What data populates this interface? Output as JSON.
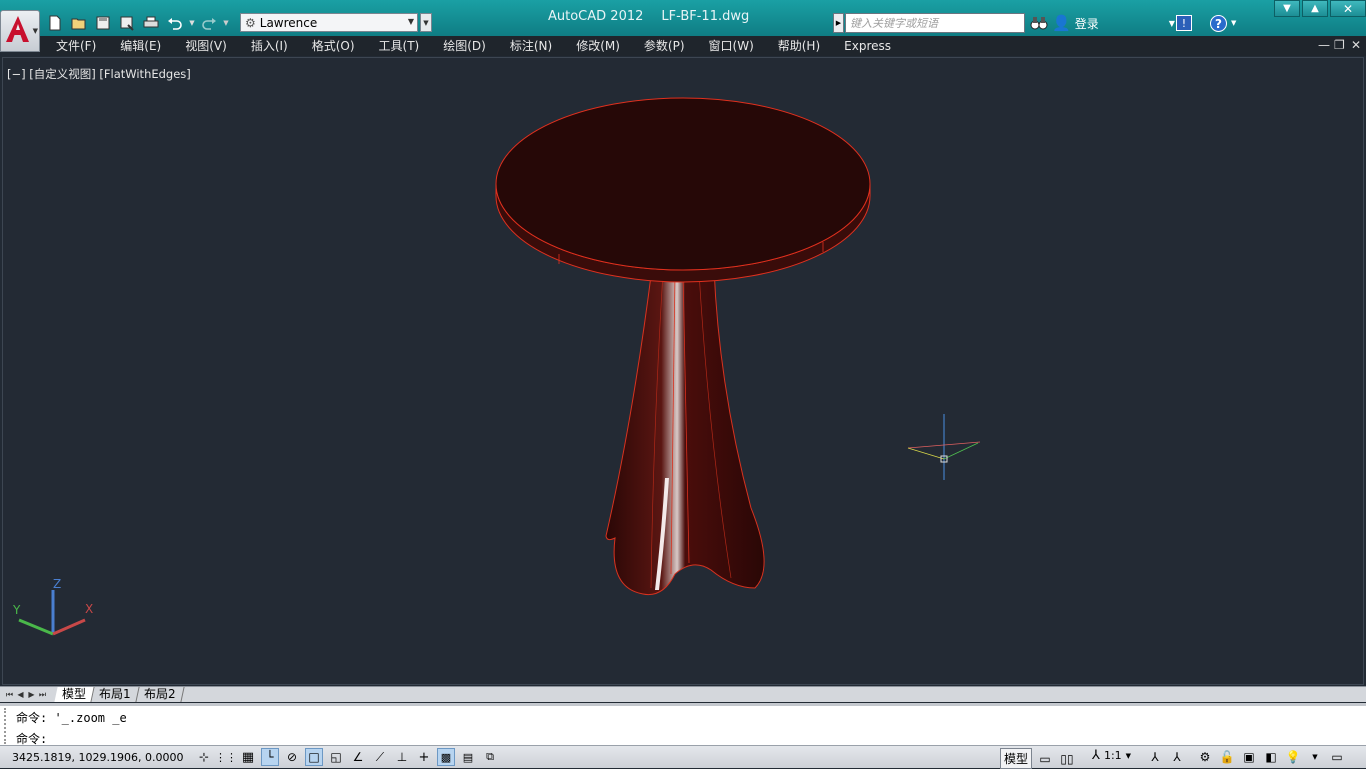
{
  "app": {
    "name": "AutoCAD 2012",
    "file": "LF-BF-11.dwg"
  },
  "quick_access": {
    "workspace": "Lawrence"
  },
  "search": {
    "placeholder": "键入关键字或短语"
  },
  "user": {
    "login_label": "登录"
  },
  "menu": {
    "items": [
      "文件(F)",
      "编辑(E)",
      "视图(V)",
      "插入(I)",
      "格式(O)",
      "工具(T)",
      "绘图(D)",
      "标注(N)",
      "修改(M)",
      "参数(P)",
      "窗口(W)",
      "帮助(H)",
      "Express"
    ]
  },
  "viewport": {
    "label": "[−] [自定义视图] [FlatWithEdges]",
    "ucs": {
      "x": "X",
      "y": "Y",
      "z": "Z"
    }
  },
  "tabs": {
    "items": [
      "模型",
      "布局1",
      "布局2"
    ],
    "active": "模型"
  },
  "command": {
    "history": "命令: '_.zoom _e",
    "prompt": "命令:"
  },
  "status": {
    "coordinates": "3425.1819,  1029.1906,  0.0000",
    "model_label": "模型",
    "scale": "1:1"
  },
  "colors": {
    "titlebar": "#138d93",
    "viewport_bg": "#232a34",
    "model_fill": "#2a0908",
    "model_edge": "#e0301e"
  }
}
